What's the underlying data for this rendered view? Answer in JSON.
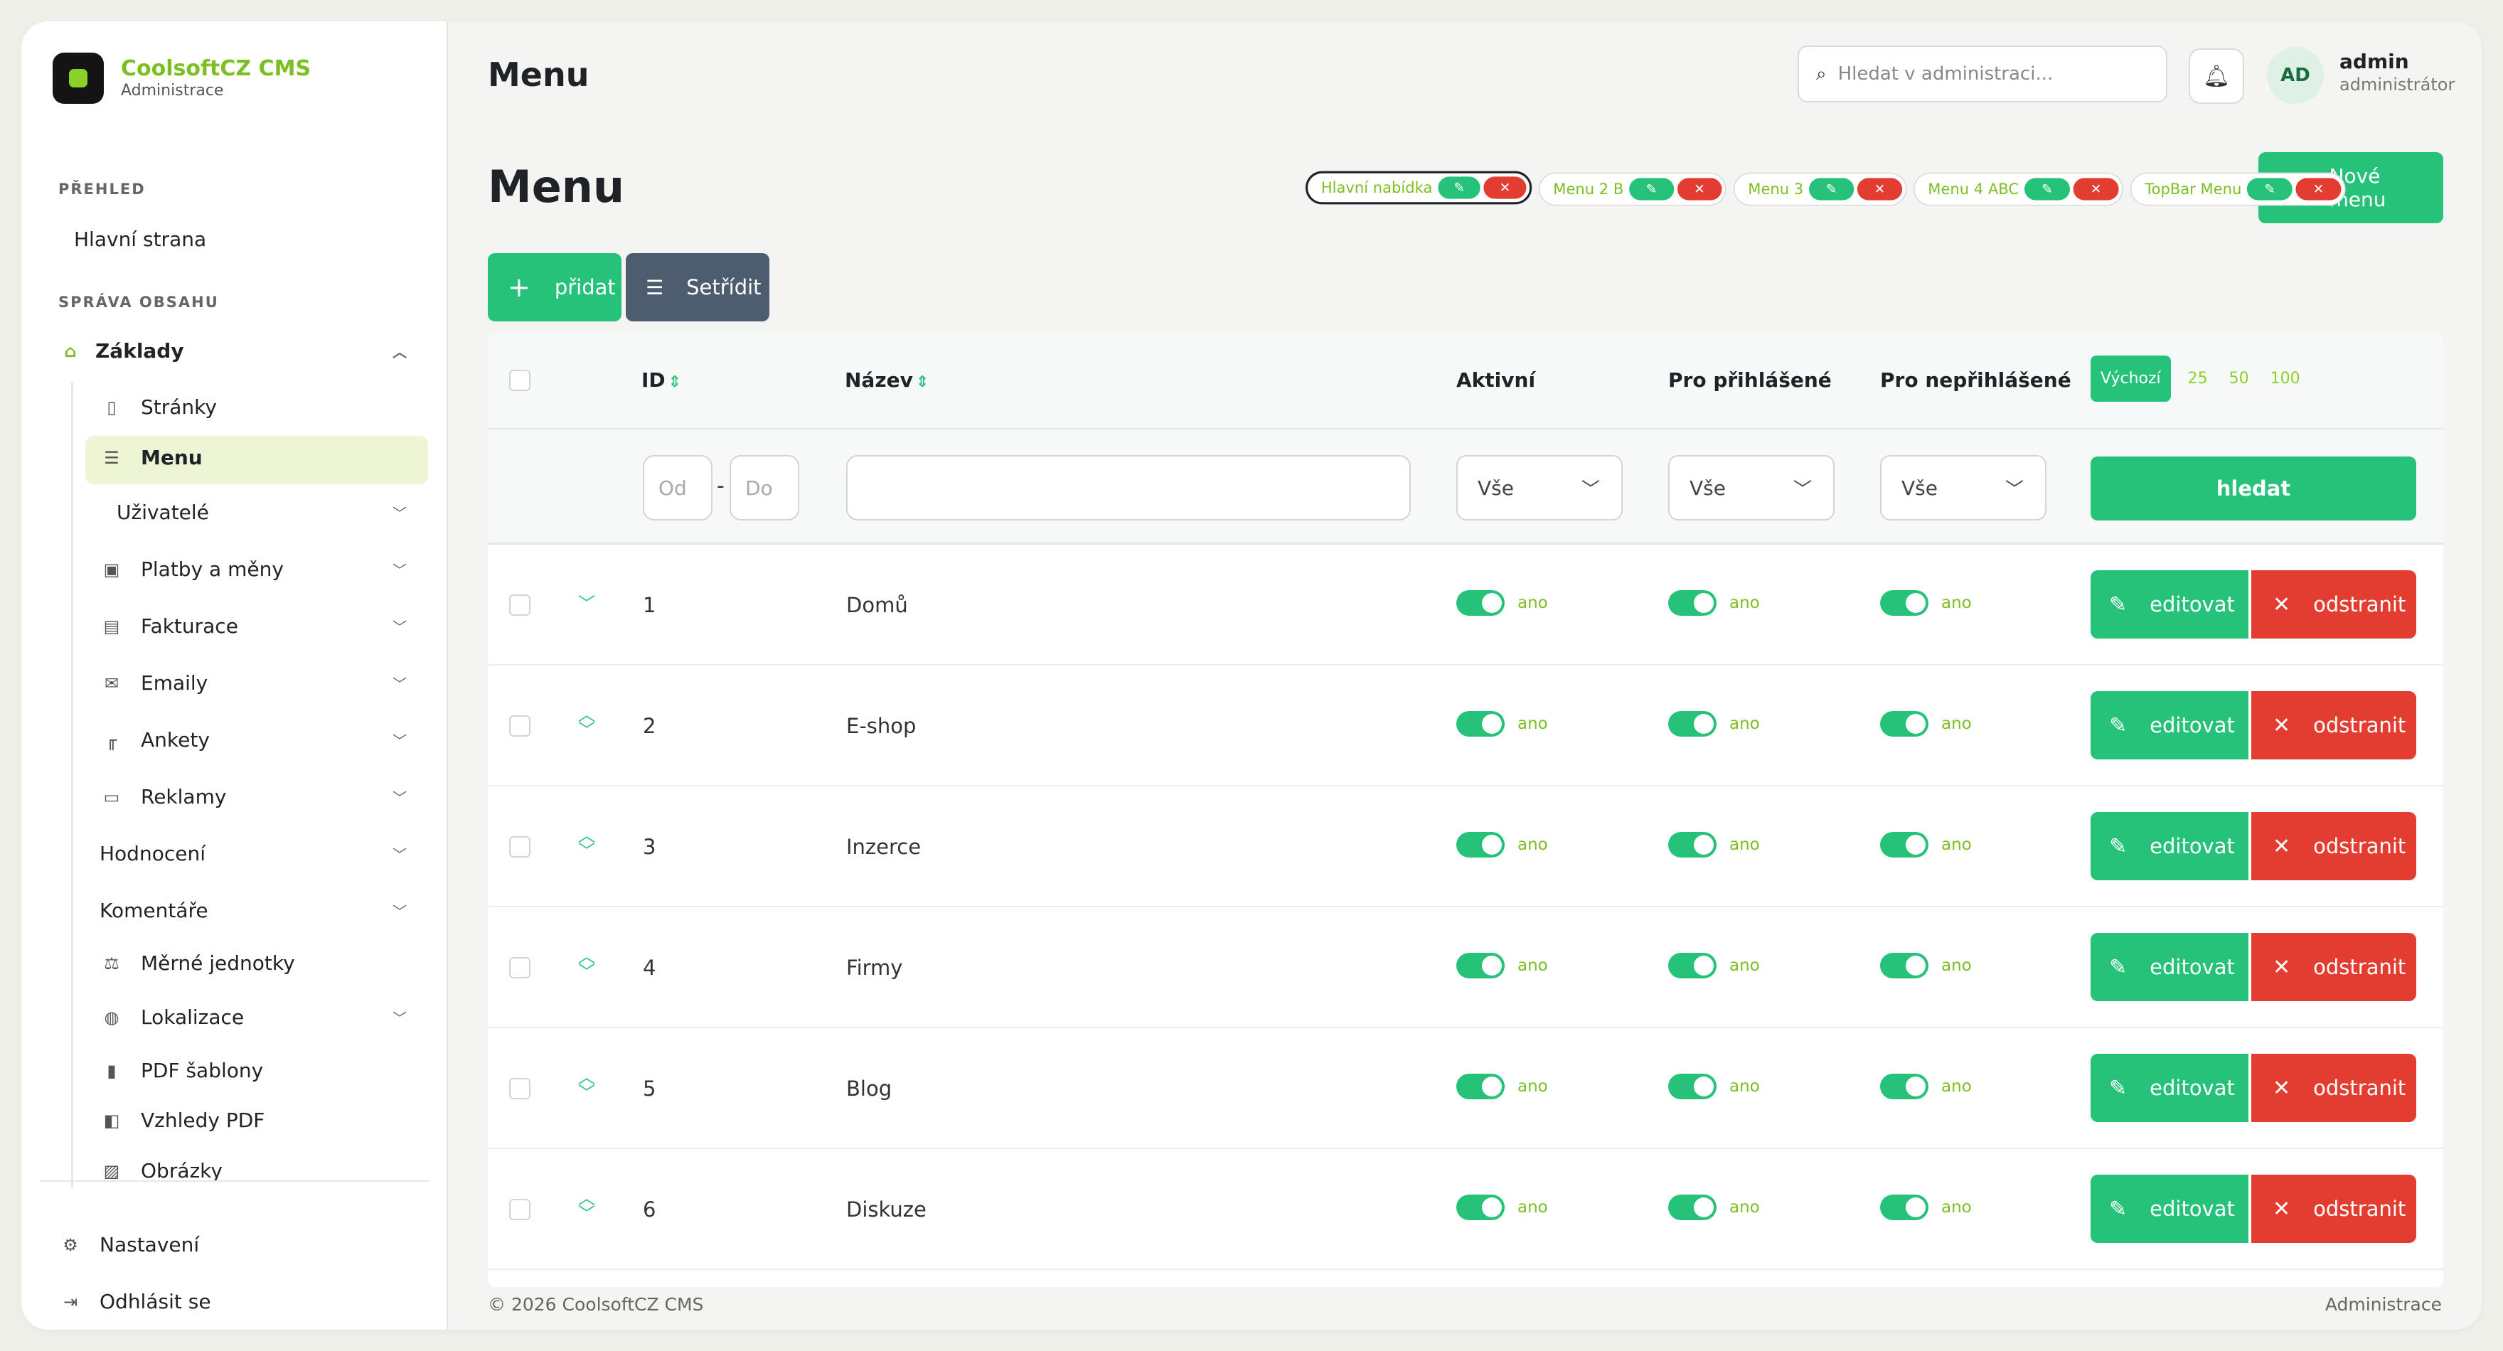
{
  "brand": {
    "name": "CoolsoftCZ CMS",
    "subtitle": "Administrace"
  },
  "sidebar": {
    "section_overview": "PŘEHLED",
    "home": "Hlavní strana",
    "section_content": "SPRÁVA OBSAHU",
    "basics": "Základy",
    "pages": "Stránky",
    "menu": "Menu",
    "users": "Uživatelé",
    "payments": "Platby a měny",
    "invoicing": "Fakturace",
    "emails": "Emaily",
    "polls": "Ankety",
    "ads": "Reklamy",
    "ratings": "Hodnocení",
    "comments": "Komentáře",
    "units": "Měrné jednotky",
    "localization": "Lokalizace",
    "pdf_templates": "PDF šablony",
    "pdf_looks": "Vzhledy PDF",
    "images": "Obrázky",
    "settings": "Nastavení",
    "logout": "Odhlásit se"
  },
  "header": {
    "title": "Menu",
    "search_placeholder": "Hledat v administraci...",
    "user_initials": "AD",
    "user_name": "admin",
    "user_role": "administrátor"
  },
  "page": {
    "title": "Menu",
    "new_menu": "Nové menu",
    "add": "přidat",
    "sort": "Setřídit"
  },
  "menu_tabs": [
    {
      "label": "Hlavní nabídka",
      "active": true
    },
    {
      "label": "Menu 2 B",
      "active": false
    },
    {
      "label": "Menu 3",
      "active": false
    },
    {
      "label": "Menu 4 ABC",
      "active": false
    },
    {
      "label": "TopBar Menu",
      "active": false
    }
  ],
  "table": {
    "columns": {
      "id": "ID",
      "name": "Název",
      "active": "Aktivní",
      "logged": "Pro přihlášené",
      "guest": "Pro nepřihlášené"
    },
    "per_page": [
      "Výchozí",
      "25",
      "50",
      "100"
    ],
    "filter": {
      "id_from": "Od",
      "id_to": "Do",
      "dash": "-",
      "all": "Vše",
      "search_button": "hledat"
    },
    "toggle_label": "ano",
    "edit_label": "editovat",
    "delete_label": "odstranit",
    "rows": [
      {
        "id": "1",
        "name": "Domů"
      },
      {
        "id": "2",
        "name": "E-shop"
      },
      {
        "id": "3",
        "name": "Inzerce"
      },
      {
        "id": "4",
        "name": "Firmy"
      },
      {
        "id": "5",
        "name": "Blog"
      },
      {
        "id": "6",
        "name": "Diskuze"
      }
    ]
  },
  "footer": {
    "copyright": "© 2026 CoolsoftCZ CMS",
    "right": "Administrace"
  },
  "colors": {
    "accent": "#27c27a",
    "brand_green": "#7cbf22",
    "danger": "#e23d30",
    "sort_button": "#4d5c6f"
  }
}
